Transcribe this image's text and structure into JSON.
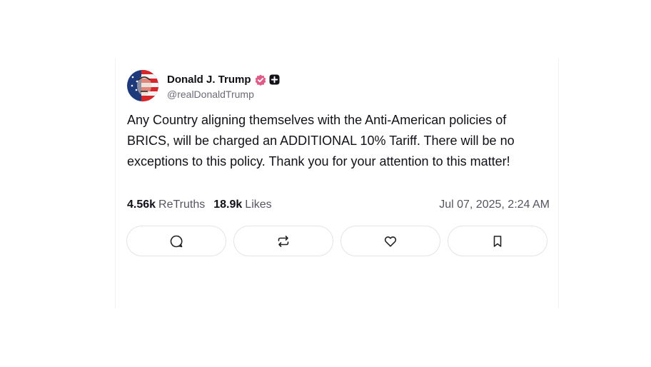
{
  "post": {
    "display_name": "Donald J. Trump",
    "handle": "@realDonaldTrump",
    "text": "Any Country aligning themselves with the Anti-American policies of BRICS, will be charged an ADDITIONAL 10% Tariff. There will be no exceptions to this policy. Thank you for your attention to this matter!",
    "retruths_count": "4.56k",
    "retruths_label": "ReTruths",
    "likes_count": "18.9k",
    "likes_label": "Likes",
    "timestamp": "Jul 07, 2025, 2:24 AM"
  },
  "icons": {
    "verified": "verified-badge-icon",
    "plus": "plus-badge-icon",
    "reply": "comment-icon",
    "retruth": "retruth-icon",
    "like": "heart-icon",
    "bookmark": "bookmark-icon"
  },
  "colors": {
    "verified_badge": "#e05b88",
    "text": "#111118",
    "muted": "#55555f",
    "button_border": "#e4e4e9"
  }
}
